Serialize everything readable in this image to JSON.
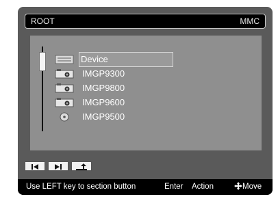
{
  "header": {
    "title": "ROOT",
    "storage": "MMC"
  },
  "tree": {
    "items": [
      {
        "label": "Device",
        "icon": "device-icon",
        "selected": true
      },
      {
        "label": "IMGP9300",
        "icon": "camera-icon"
      },
      {
        "label": "IMGP9800",
        "icon": "camera-icon"
      },
      {
        "label": "IMGP9600",
        "icon": "camera-icon"
      },
      {
        "label": "IMGP9500",
        "icon": "disc-icon"
      }
    ]
  },
  "controls": [
    {
      "icon": "skip-previous-icon"
    },
    {
      "icon": "skip-next-icon"
    },
    {
      "icon": "up-folder-icon"
    }
  ],
  "footer": {
    "hint": "Use LEFT key to section button",
    "enter": "Enter",
    "action": "Action",
    "move": "Move"
  }
}
